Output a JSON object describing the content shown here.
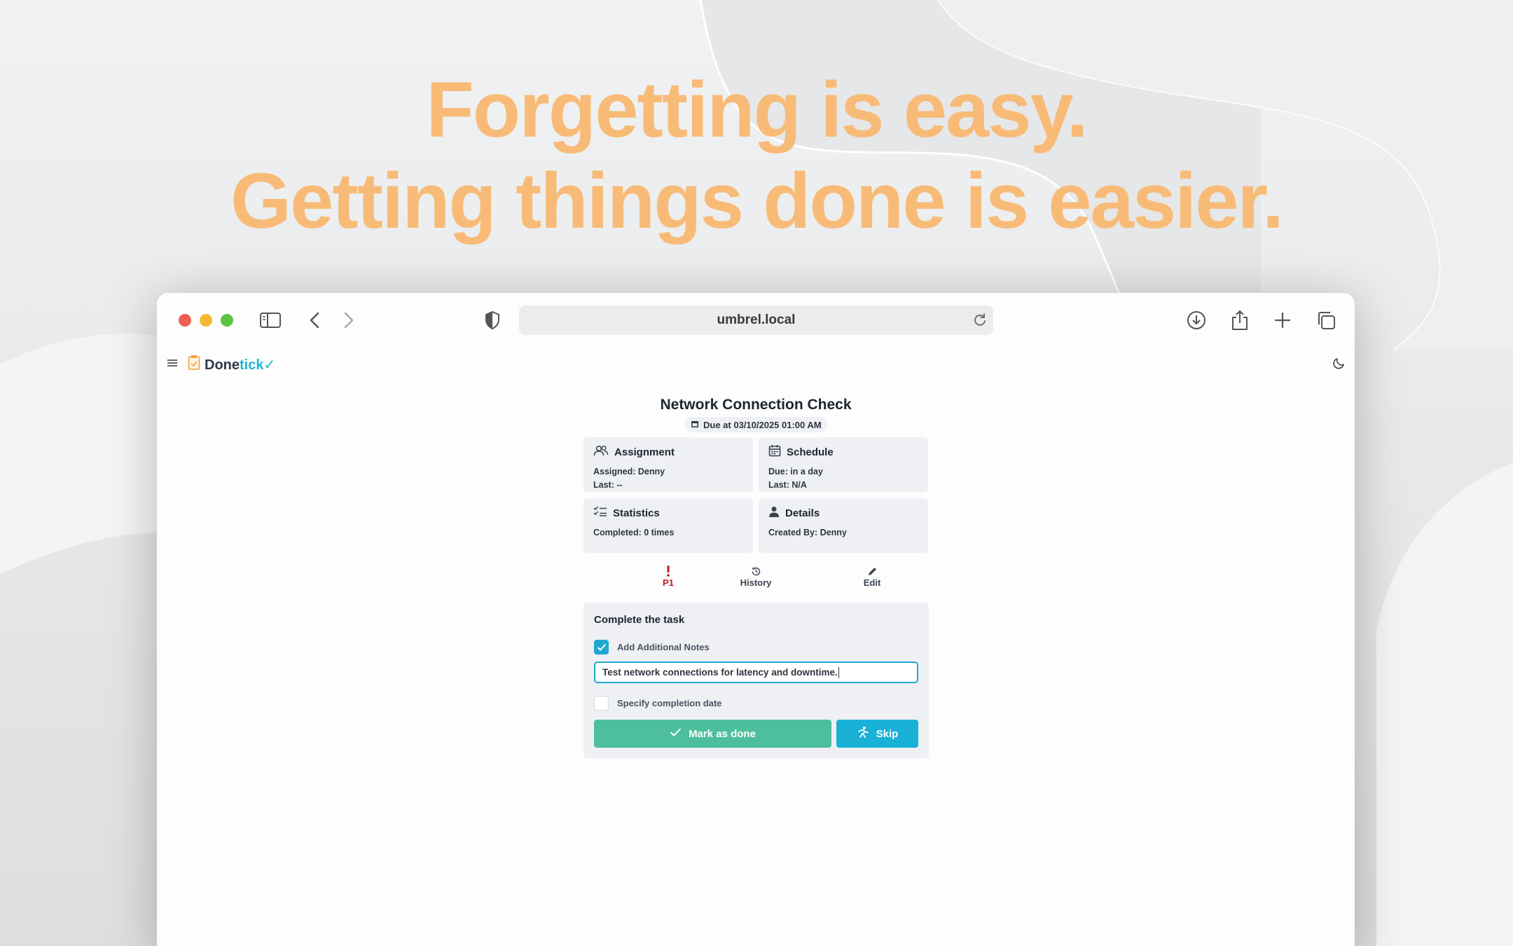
{
  "headline": {
    "line1": "Forgetting is easy.",
    "line2": "Getting things done is easier."
  },
  "browser": {
    "url": "umbrel.local"
  },
  "app": {
    "name_part1": "Done",
    "name_part2": "tick"
  },
  "task": {
    "title": "Network Connection Check",
    "due": "Due at 03/10/2025 01:00 AM",
    "cards": {
      "assignment": {
        "heading": "Assignment",
        "line1": "Assigned: Denny",
        "line2": "Last: --"
      },
      "schedule": {
        "heading": "Schedule",
        "line1": "Due: in a day",
        "line2": "Last: N/A"
      },
      "statistics": {
        "heading": "Statistics",
        "line1": "Completed: 0 times"
      },
      "details": {
        "heading": "Details",
        "line1": "Created By: Denny"
      }
    },
    "actions": {
      "priority": "P1",
      "history": "History",
      "edit": "Edit"
    },
    "complete": {
      "title": "Complete the task",
      "notes_label": "Add Additional Notes",
      "notes_checked": true,
      "notes_value": "Test network connections for latency and downtime.",
      "date_label": "Specify completion date",
      "date_checked": false,
      "done_label": "Mark as done",
      "skip_label": "Skip"
    }
  },
  "colors": {
    "headline": "#f8bb77",
    "brand_tick": "#1fb4d6",
    "done_button": "#4dbf9c",
    "skip_button": "#19b1d5",
    "priority": "#c41a1a"
  }
}
